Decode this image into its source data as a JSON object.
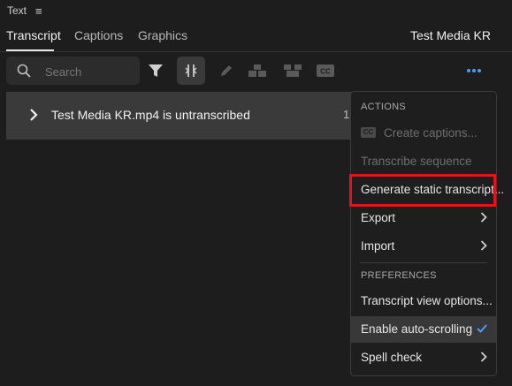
{
  "panel": {
    "title": "Text"
  },
  "tabs": [
    {
      "label": "Transcript",
      "active": true
    },
    {
      "label": "Captions",
      "active": false
    },
    {
      "label": "Graphics",
      "active": false
    }
  ],
  "media_name": "Test Media KR",
  "search": {
    "placeholder": "Search"
  },
  "toolbar_icons": [
    "search-icon",
    "filter-icon",
    "merge-segments-icon",
    "pencil-icon",
    "split-icon",
    "join-icon",
    "cc-icon",
    "more-icon"
  ],
  "clip": {
    "name": "Test Media KR.mp4 is untranscribed",
    "count": "1"
  },
  "menu": {
    "actions_header": "ACTIONS",
    "create_captions": "Create captions...",
    "cc_badge": "CC",
    "transcribe_sequence": "Transcribe sequence",
    "generate_static": "Generate static transcript...",
    "export": "Export",
    "import": "Import",
    "preferences_header": "PREFERENCES",
    "transcript_view_options": "Transcript view options...",
    "enable_auto_scrolling": "Enable auto-scrolling",
    "spell_check": "Spell check"
  },
  "colors": {
    "accent": "#4b9cf5",
    "highlight_box": "#e0131f"
  }
}
